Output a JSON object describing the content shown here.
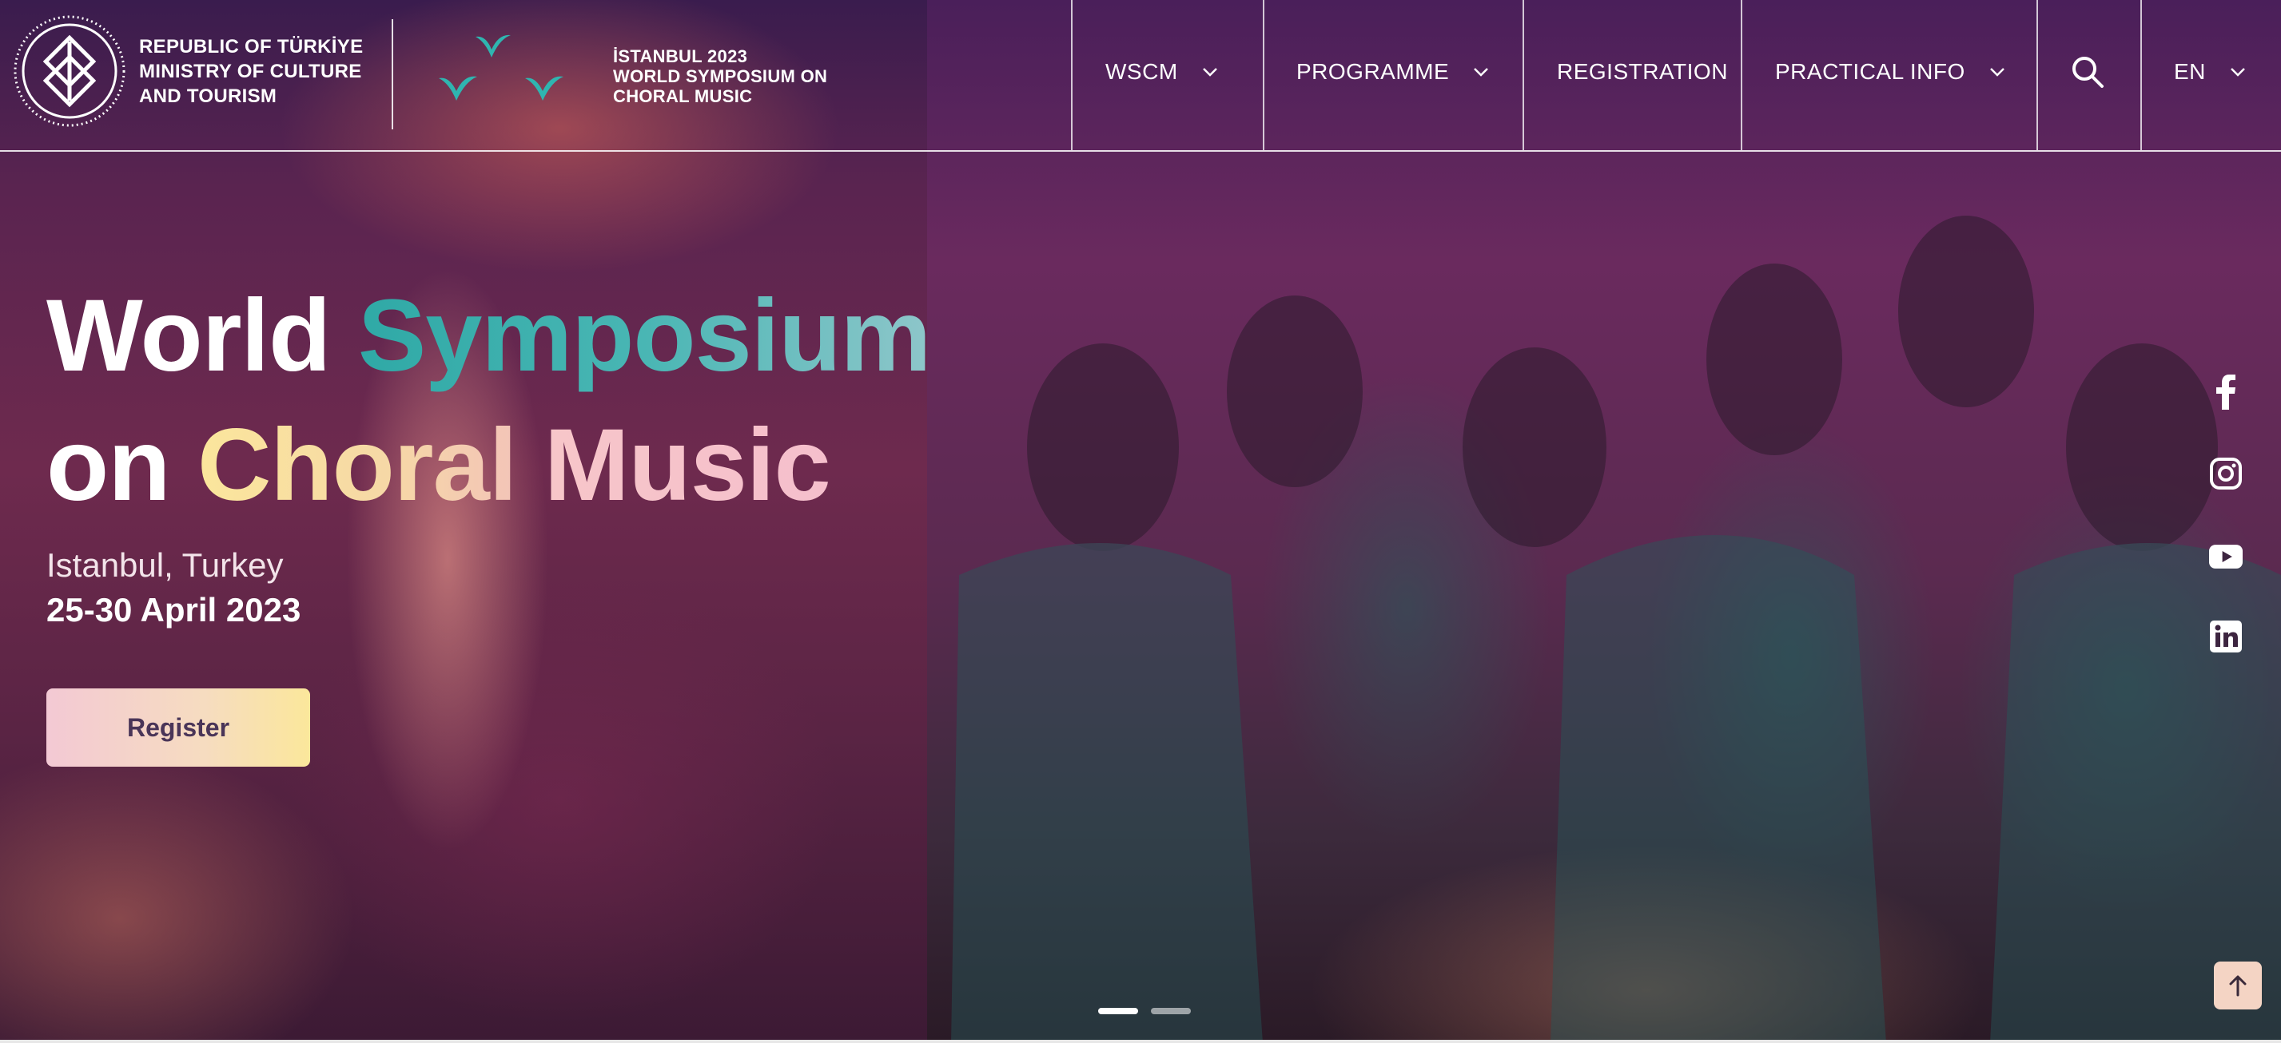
{
  "header": {
    "ministry_lines": [
      "REPUBLIC OF TÜRKİYE",
      "MINISTRY OF CULTURE",
      "AND TOURISM"
    ],
    "event_lines": [
      "İSTANBUL 2023",
      "WORLD SYMPOSIUM ON",
      "CHORAL MUSIC"
    ]
  },
  "nav": {
    "items": [
      {
        "label": "WSCM",
        "has_dropdown": true
      },
      {
        "label": "PROGRAMME",
        "has_dropdown": true
      },
      {
        "label": "REGISTRATION",
        "has_dropdown": false
      },
      {
        "label": "PRACTICAL INFO",
        "has_dropdown": true
      }
    ],
    "search_icon": "search-icon",
    "language": {
      "label": "EN",
      "has_dropdown": true
    }
  },
  "hero": {
    "title_parts": [
      "World",
      "Symposium",
      "on",
      "Choral",
      "Music"
    ],
    "location": "Istanbul, Turkey",
    "dates": "25-30 April 2023",
    "register_label": "Register"
  },
  "social": [
    "facebook-icon",
    "instagram-icon",
    "youtube-icon",
    "linkedin-icon"
  ],
  "slider": {
    "count": 2,
    "active": 1
  },
  "colors": {
    "teal": "#2fa9a6",
    "yellow": "#fbe69c",
    "pink": "#f7c6c9",
    "button_text": "#4a3558"
  }
}
